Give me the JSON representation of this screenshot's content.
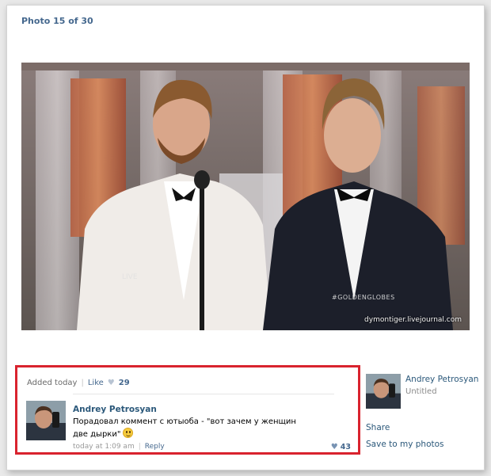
{
  "viewer": {
    "counter": "Photo 15 of 30"
  },
  "photo": {
    "watermark": "dymontiger.livejournal.com",
    "event_tag": "#GOLDENGLOBES",
    "podium_text": "LIVE"
  },
  "stats": {
    "added": "Added today",
    "like_label": "Like",
    "like_count": "29"
  },
  "comment": {
    "author": "Andrey Petrosyan",
    "text": "Порадовал коммент с ютыоба - \"вот зачем у женщин две дырки\"",
    "time": "today at 1:09 am",
    "reply_label": "Reply",
    "likes": "43"
  },
  "sidebar": {
    "owner_name": "Andrey Petrosyan",
    "album": "Untitled",
    "share_label": "Share",
    "save_label": "Save to my photos"
  },
  "colors": {
    "link": "#2b587a",
    "accent_link": "#45688e",
    "highlight_border": "#d9232e"
  }
}
